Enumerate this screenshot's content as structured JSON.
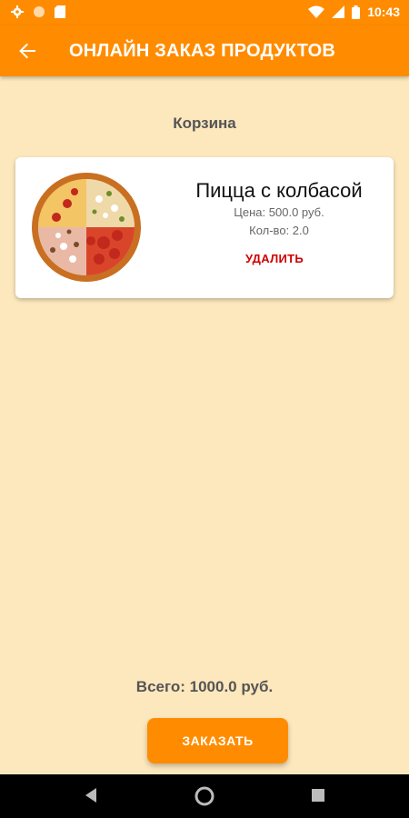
{
  "status_bar": {
    "time": "10:43",
    "left_icons": [
      "gear-icon",
      "circle-icon",
      "sd-card-icon"
    ],
    "right_icons": [
      "wifi-icon",
      "signal-icon",
      "battery-icon"
    ]
  },
  "app_bar": {
    "title": "ОНЛАЙН ЗАКАЗ ПРОДУКТОВ",
    "back_icon": "arrow-back-icon"
  },
  "cart": {
    "title": "Корзина",
    "items": [
      {
        "name": "Пицца с колбасой",
        "price_label": "Цена:",
        "price": "500.0 руб.",
        "qty_label": "Кол-во:",
        "qty": "2.0",
        "delete_label": "УДАЛИТЬ",
        "image_icon": "pizza-image"
      }
    ]
  },
  "total": {
    "label": "Всего:",
    "value": "1000.0 руб."
  },
  "order_button": "ЗАКАЗАТЬ",
  "nav_bar": [
    "back-triangle-icon",
    "home-circle-icon",
    "recents-square-icon"
  ],
  "colors": {
    "accent": "#ff8c00",
    "background": "#fde8bd",
    "delete": "#d00000"
  }
}
